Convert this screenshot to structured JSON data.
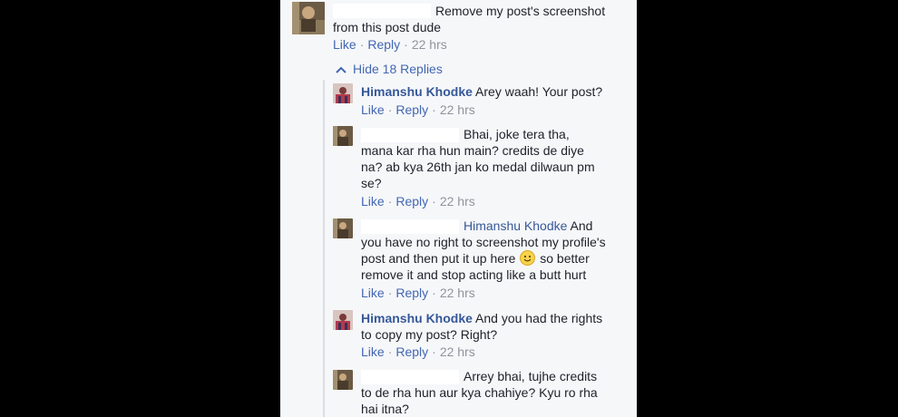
{
  "thread": {
    "top_comment": {
      "text_line1": "Remove my post's screenshot",
      "text_line2": "from this post dude",
      "actions": {
        "like": "Like",
        "reply": "Reply",
        "time": "22 hrs"
      }
    },
    "hide_replies_label": "Hide 18 Replies",
    "replies": [
      {
        "author": "Himanshu Khodke",
        "text": "Arey waah! Your post?",
        "actions": {
          "like": "Like",
          "reply": "Reply",
          "time": "22 hrs"
        }
      },
      {
        "text_line1": "Bhai, joke tera tha,",
        "text_line2": "mana kar rha hun main? credits de diye",
        "text_line3": "na? ab kya 26th jan ko medal dilwaun pm",
        "text_line4": "se?",
        "actions": {
          "like": "Like",
          "reply": "Reply",
          "time": "22 hrs"
        }
      },
      {
        "mention": "Himanshu Khodke",
        "text_line1_rest": "And",
        "text_line2": "you have no right to screenshot my profile's",
        "text_line3_before": "post and then put it up here",
        "text_line3_after": "so better",
        "text_line4": "remove it and stop acting like a butt hurt",
        "actions": {
          "like": "Like",
          "reply": "Reply",
          "time": "22 hrs"
        }
      },
      {
        "author": "Himanshu Khodke",
        "text_line1": "And you had the rights",
        "text_line2": "to copy my post? Right?",
        "actions": {
          "like": "Like",
          "reply": "Reply",
          "time": "22 hrs"
        }
      },
      {
        "text_line1": "Arrey bhai, tujhe credits",
        "text_line2": "to de rha hun aur kya chahiye? Kyu ro rha",
        "text_line3": "hai itna?"
      }
    ]
  },
  "icons": {
    "hide_replies": "chevron-up-icon",
    "smiley": "smiley-emoji-icon"
  },
  "colors": {
    "panel_bg": "#f6f7f9",
    "outer_bg": "#000000",
    "name_blue": "#365899",
    "link_blue": "#4267b2",
    "meta_gray": "#90949c"
  }
}
